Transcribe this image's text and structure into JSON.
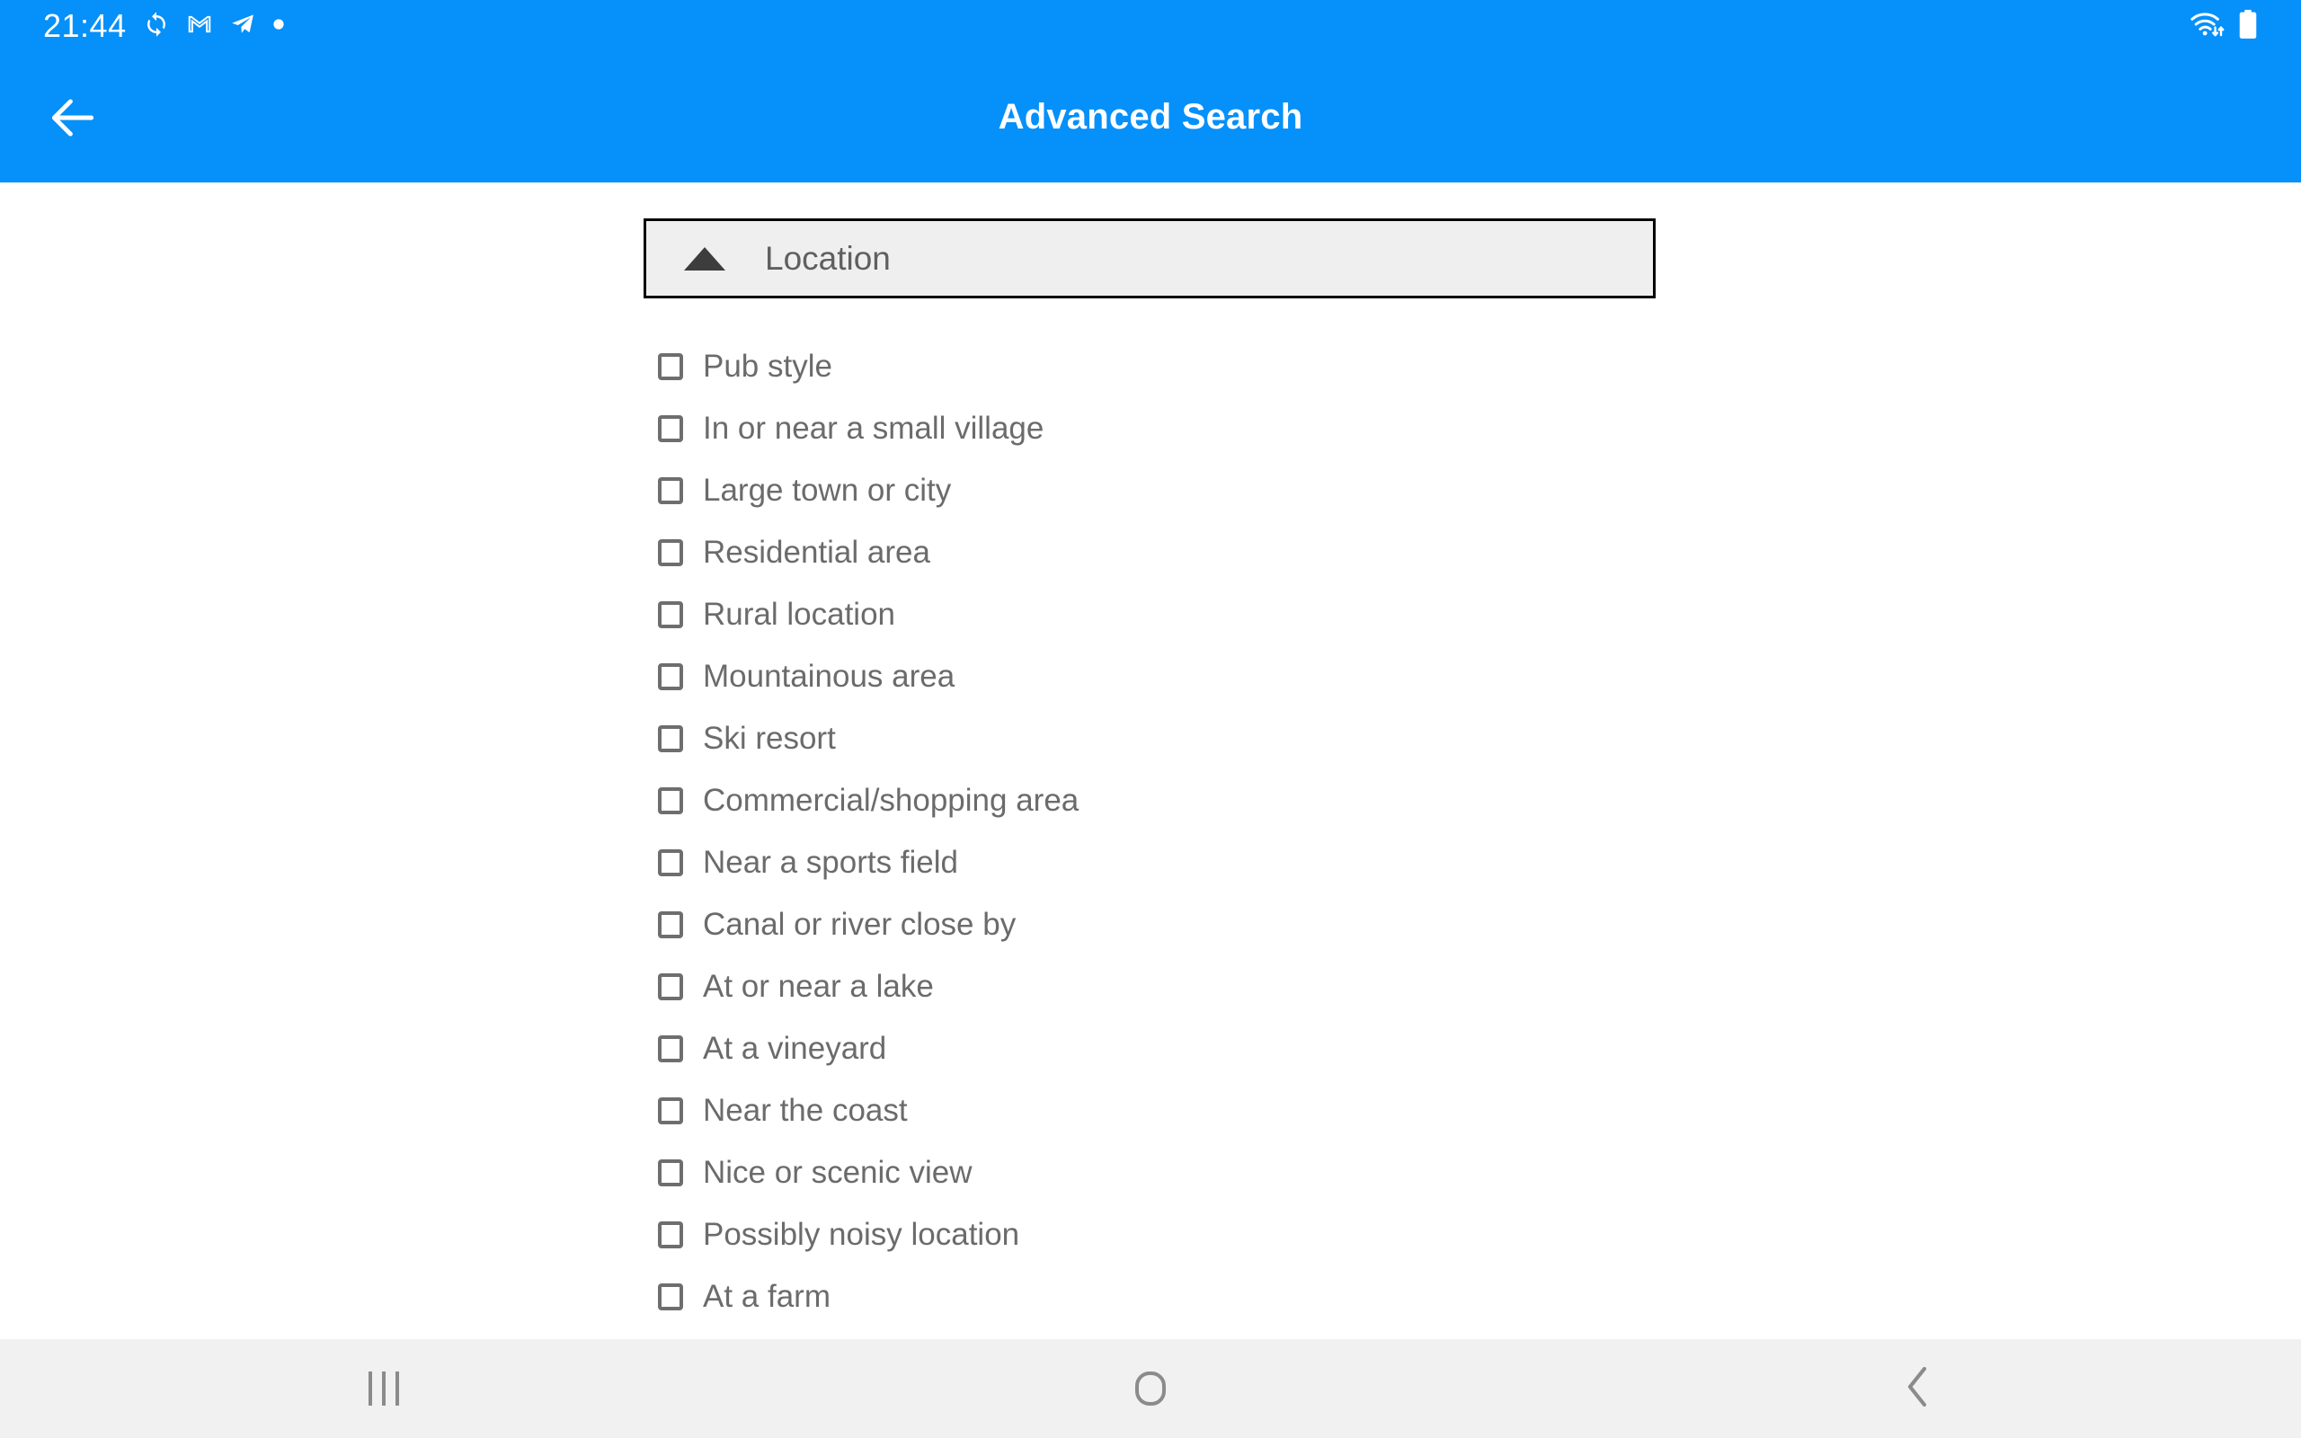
{
  "status_bar": {
    "clock": "21:44",
    "left_icons": [
      "sync-icon",
      "gmail-icon",
      "telegram-icon",
      "dot-icon"
    ],
    "right_icons": [
      "wifi-icon",
      "battery-icon"
    ]
  },
  "app_bar": {
    "back_icon": "back-arrow-icon",
    "title": "Advanced Search",
    "background_color": "#0590fa",
    "text_color": "#ffffff"
  },
  "section": {
    "title": "Location",
    "caret_icon": "triangle-up-icon",
    "expanded": true,
    "background_color": "#efefef",
    "border_color": "#000000"
  },
  "options": [
    {
      "label": "Pub style",
      "checked": false
    },
    {
      "label": "In or near a small village",
      "checked": false
    },
    {
      "label": "Large town or city",
      "checked": false
    },
    {
      "label": "Residential area",
      "checked": false
    },
    {
      "label": "Rural location",
      "checked": false
    },
    {
      "label": "Mountainous area",
      "checked": false
    },
    {
      "label": "Ski resort",
      "checked": false
    },
    {
      "label": "Commercial/shopping area",
      "checked": false
    },
    {
      "label": "Near a sports field",
      "checked": false
    },
    {
      "label": "Canal or river close by",
      "checked": false
    },
    {
      "label": "At or near a lake",
      "checked": false
    },
    {
      "label": "At a vineyard",
      "checked": false
    },
    {
      "label": "Near the coast",
      "checked": false
    },
    {
      "label": "Nice or scenic view",
      "checked": false
    },
    {
      "label": "Possibly noisy location",
      "checked": false
    },
    {
      "label": "At a farm",
      "checked": false
    },
    {
      "label": "",
      "checked": false
    }
  ],
  "nav_bar": {
    "recents_label": "recents-icon",
    "home_label": "home-icon",
    "back_label": "back-chevron-icon",
    "background_color": "#f1f1f1",
    "icon_color": "#8b8b8b"
  }
}
